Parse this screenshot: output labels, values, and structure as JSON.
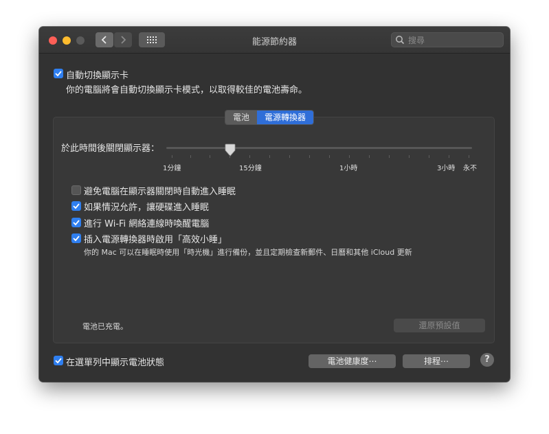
{
  "window": {
    "title": "能源節約器",
    "search_placeholder": "搜尋"
  },
  "toolbar": {
    "back_icon": "chevron-left-icon",
    "forward_icon": "chevron-right-icon",
    "show_all_icon": "grid-icon"
  },
  "auto_switch": {
    "checked": true,
    "label": "自動切換顯示卡",
    "description": "你的電腦將會自動切換顯示卡模式，以取得較佳的電池壽命。"
  },
  "tabs": [
    {
      "label": "電池",
      "active": false
    },
    {
      "label": "電源轉換器",
      "active": true
    }
  ],
  "display_sleep": {
    "label": "於此時間後關閉顯示器：",
    "value": "15分鐘",
    "ticks": [
      "1分鐘",
      "15分鐘",
      "1小時",
      "3小時",
      "永不"
    ]
  },
  "options": [
    {
      "checked": false,
      "label": "避免電腦在顯示器關閉時自動進入睡眠"
    },
    {
      "checked": true,
      "label": "如果情況允許，讓硬碟進入睡眠"
    },
    {
      "checked": true,
      "label": "進行 Wi-Fi 網絡連線時喚醒電腦"
    },
    {
      "checked": true,
      "label": "插入電源轉換器時啟用「高效小睡」",
      "description": "你的 Mac 可以在睡眠時使用「時光機」進行備份，並且定期檢查新郵件、日曆和其他 iCloud 更新"
    }
  ],
  "status": {
    "text": "電池已充電。",
    "restore_button": "還原預設值"
  },
  "footer": {
    "menu_bar_checked": true,
    "menu_bar_label": "在選單列中顯示電池狀態",
    "battery_health_button": "電池健康度⋯",
    "schedule_button": "排程⋯",
    "help_label": "?"
  },
  "colors": {
    "accent": "#2f7ff0",
    "window_bg": "#323232",
    "panel_bg": "#383838"
  }
}
